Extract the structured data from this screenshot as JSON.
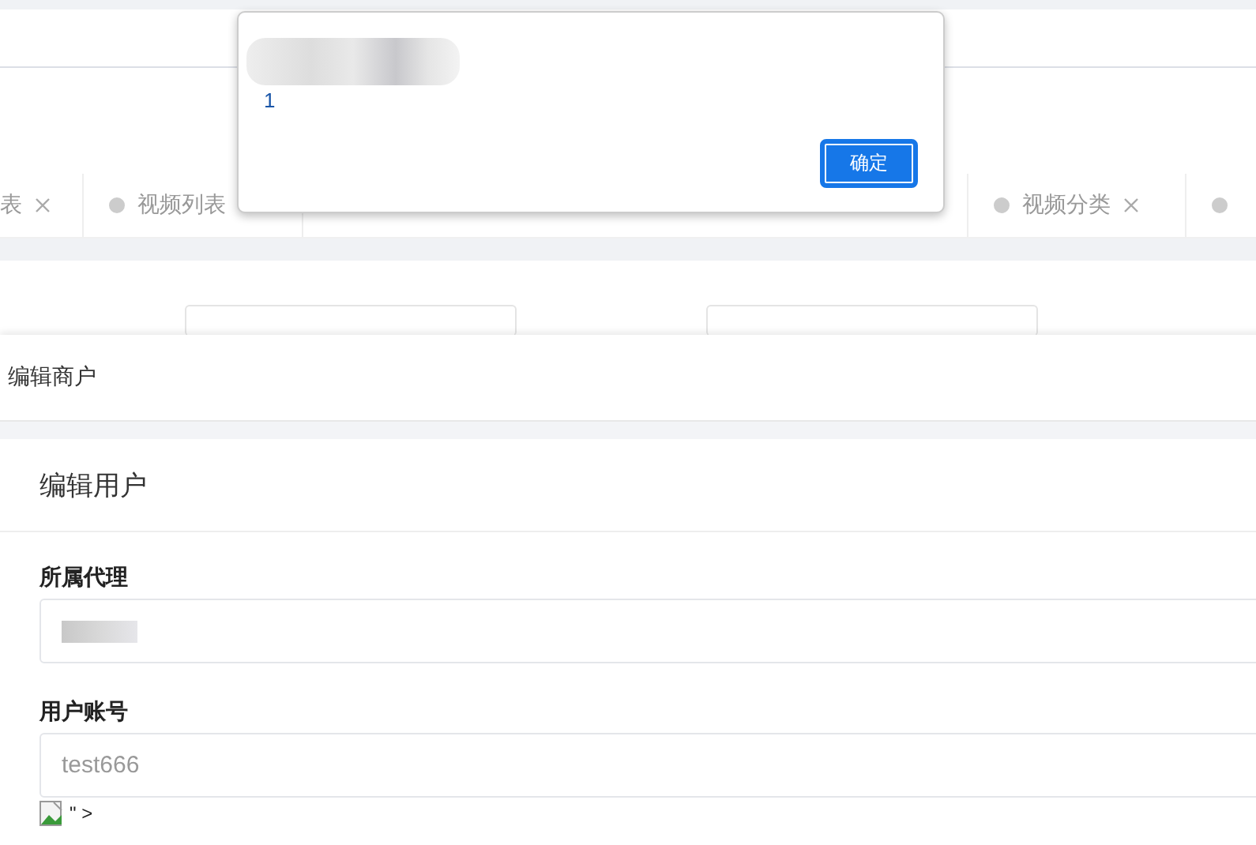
{
  "tabs": [
    {
      "label": "表",
      "closable": true,
      "selected": false
    },
    {
      "label": "视频列表",
      "selected": false
    },
    {
      "label": "视频分类",
      "closable": true,
      "selected": false
    },
    {
      "selected": false
    }
  ],
  "dialog": {
    "message": "1",
    "button": "确定"
  },
  "drawer": {
    "title": "编辑商户",
    "card_title": "编辑用户",
    "fields": [
      {
        "label": "所属代理",
        "kind": "redacted"
      },
      {
        "label": "用户账号",
        "kind": "text",
        "value": "test666"
      }
    ],
    "broken_image_text": "\" >"
  }
}
